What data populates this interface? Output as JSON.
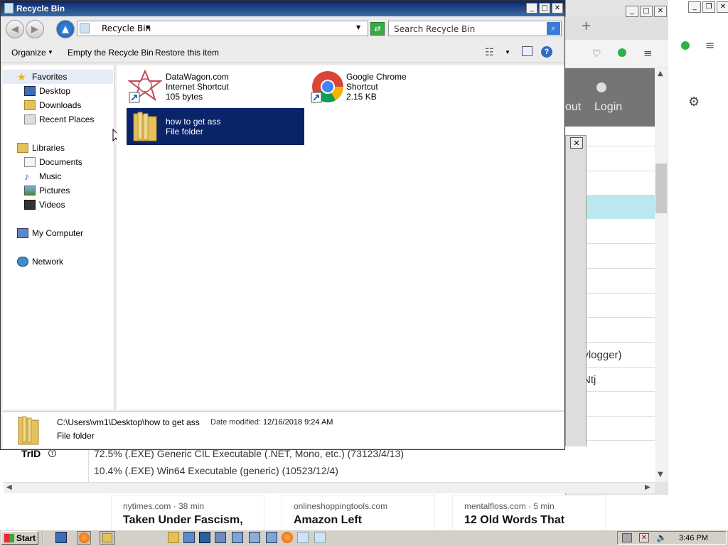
{
  "explorer": {
    "title": "Recycle Bin",
    "address": "Recycle Bin",
    "search_placeholder": "Search Recycle Bin",
    "toolbar": {
      "organize": "Organize",
      "empty": "Empty the Recycle Bin",
      "restore": "Restore this item"
    },
    "nav": {
      "favorites": "Favorites",
      "desktop": "Desktop",
      "downloads": "Downloads",
      "recent": "Recent Places",
      "libraries": "Libraries",
      "documents": "Documents",
      "music": "Music",
      "pictures": "Pictures",
      "videos": "Videos",
      "computer": "My Computer",
      "network": "Network"
    },
    "items": [
      {
        "name": "DataWagon.com",
        "type": "Internet Shortcut",
        "size": "105 bytes"
      },
      {
        "name": "Google Chrome",
        "type": "Shortcut",
        "size": "2.15 KB"
      },
      {
        "name": "how to get ass",
        "type": "File folder"
      }
    ],
    "details": {
      "path": "C:\\Users\\vm1\\Desktop\\how to get ass",
      "modified_label": "Date modified:",
      "modified": "12/16/2018 9:24 AM",
      "type": "File folder"
    }
  },
  "browser": {
    "header_about": "out",
    "header_login": "Login",
    "text_keylogger": "eylogger)",
    "text_ntj": "Ntj",
    "trid_label": "TrID",
    "trid_line1": "72.5% (.EXE) Generic CIL Executable (.NET, Mono, etc.) (73123/4/13)",
    "trid_line2": "10.4% (.EXE) Win64 Executable (generic) (10523/12/4)",
    "cards": [
      {
        "source": "nytimes.com · 38 min",
        "title": "Taken Under Fascism,"
      },
      {
        "source": "onlineshoppingtools.com",
        "title": "Amazon Left"
      },
      {
        "source": "mentalfloss.com · 5 min",
        "title": "12 Old Words That"
      }
    ]
  },
  "taskbar": {
    "start": "Start",
    "clock": "3:46 PM"
  }
}
